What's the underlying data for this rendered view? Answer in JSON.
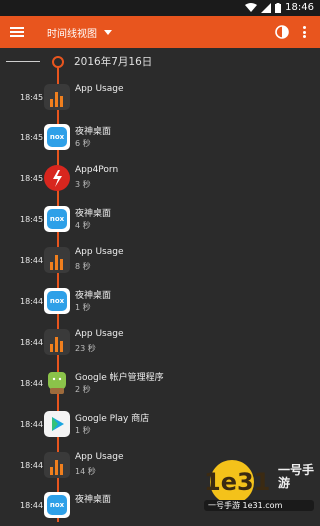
{
  "statusbar": {
    "time": "18:46"
  },
  "appbar": {
    "title": "时间线视图"
  },
  "timeline": {
    "date": "2016年7月16日",
    "entries": [
      {
        "time": "18:45",
        "name": "App Usage",
        "duration": "",
        "icon": "app-usage-icon"
      },
      {
        "time": "18:45",
        "name": "夜神桌面",
        "duration": "6 秒",
        "icon": "nox-icon"
      },
      {
        "time": "18:45",
        "name": "App4Porn",
        "duration": "3 秒",
        "icon": "app4porn-icon"
      },
      {
        "time": "18:45",
        "name": "夜神桌面",
        "duration": "4 秒",
        "icon": "nox-icon"
      },
      {
        "time": "18:44",
        "name": "App Usage",
        "duration": "8 秒",
        "icon": "app-usage-icon"
      },
      {
        "time": "18:44",
        "name": "夜神桌面",
        "duration": "1 秒",
        "icon": "nox-icon"
      },
      {
        "time": "18:44",
        "name": "App Usage",
        "duration": "23 秒",
        "icon": "app-usage-icon"
      },
      {
        "time": "18:44",
        "name": "Google 帐户管理程序",
        "duration": "2 秒",
        "icon": "android-icon"
      },
      {
        "time": "18:44",
        "name": "Google Play 商店",
        "duration": "1 秒",
        "icon": "play-store-icon"
      },
      {
        "time": "18:44",
        "name": "App Usage",
        "duration": "14 秒",
        "icon": "app-usage-icon"
      },
      {
        "time": "18:44",
        "name": "夜神桌面",
        "duration": "",
        "icon": "nox-icon"
      }
    ]
  },
  "watermark": {
    "text": "1e31",
    "site": "一号手游 1e31.com",
    "brand": "一号手游"
  },
  "colors": {
    "accent": "#e8551e",
    "background": "#2b2b2b"
  }
}
